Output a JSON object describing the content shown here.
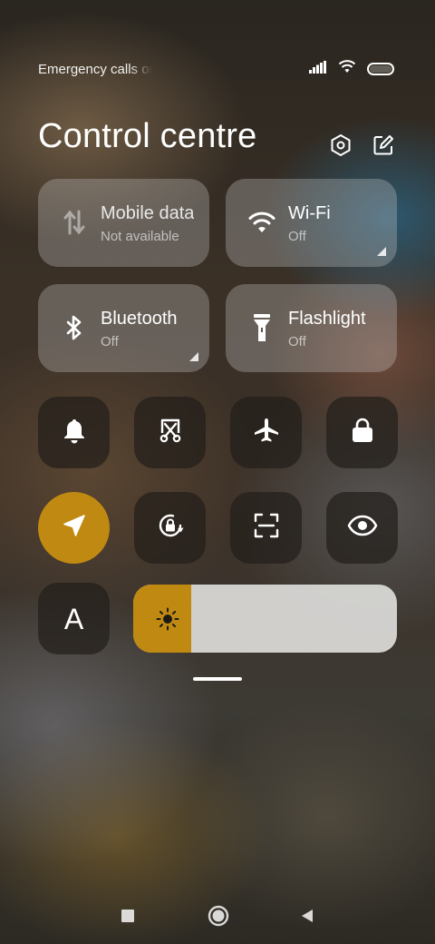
{
  "status_bar": {
    "text": "Emergency calls only",
    "icons": [
      "signal-icon",
      "wifi-icon",
      "battery-icon"
    ]
  },
  "header": {
    "title": "Control centre",
    "icons": [
      "settings-icon",
      "edit-icon"
    ]
  },
  "tiles": [
    {
      "label": "Mobile data",
      "sub": "Not available",
      "icon": "mobile-data-icon"
    },
    {
      "label": "Wi-Fi",
      "sub": "Off",
      "icon": "wifi-icon"
    },
    {
      "label": "Bluetooth",
      "sub": "Off",
      "icon": "bluetooth-icon"
    },
    {
      "label": "Flashlight",
      "sub": "Off",
      "icon": "flashlight-icon"
    }
  ],
  "toggles_row1": [
    "bell-icon",
    "screenshot-icon",
    "airplane-icon",
    "lock-icon"
  ],
  "toggles_row2": [
    "location-icon",
    "rotation-lock-icon",
    "scanner-icon",
    "eye-icon"
  ],
  "toggles_row3": {
    "auto_brightness_label": "A",
    "brightness_level": 0.22
  },
  "colors": {
    "accent": "#c08a12",
    "tile_bg": "#c8c8c8",
    "button_bg": "#231e1a"
  },
  "nav_bar": [
    "recent-apps-icon",
    "home-icon",
    "back-icon"
  ]
}
